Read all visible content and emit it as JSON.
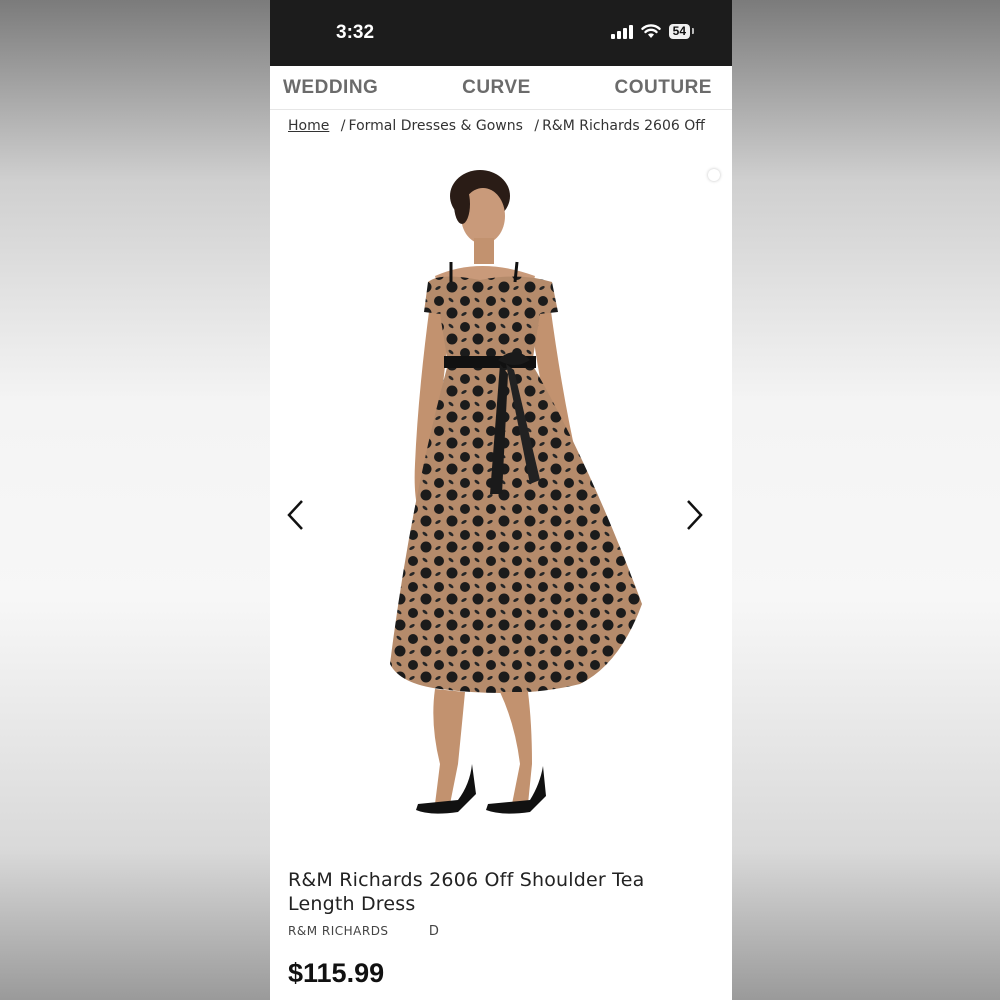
{
  "status_bar": {
    "time": "3:32",
    "battery": "54"
  },
  "category_nav": [
    {
      "label": "WEDDING"
    },
    {
      "label": "CURVE"
    },
    {
      "label": "COUTURE"
    }
  ],
  "breadcrumb": {
    "home": "Home",
    "separator": "/",
    "category": "Formal Dresses & Gowns",
    "current": "R&M Richards 2606 Off"
  },
  "product": {
    "title": "R&M Richards 2606 Off Shoulder Tea Length Dress",
    "brand": "R&M RICHARDS",
    "code": "D",
    "price": "$115.99"
  },
  "colors": {
    "status_bar_bg": "#1c1c1c",
    "nav_text": "#6b6b6b",
    "dress_base": "#b48a6a",
    "dress_pattern": "#1a1a1a"
  }
}
